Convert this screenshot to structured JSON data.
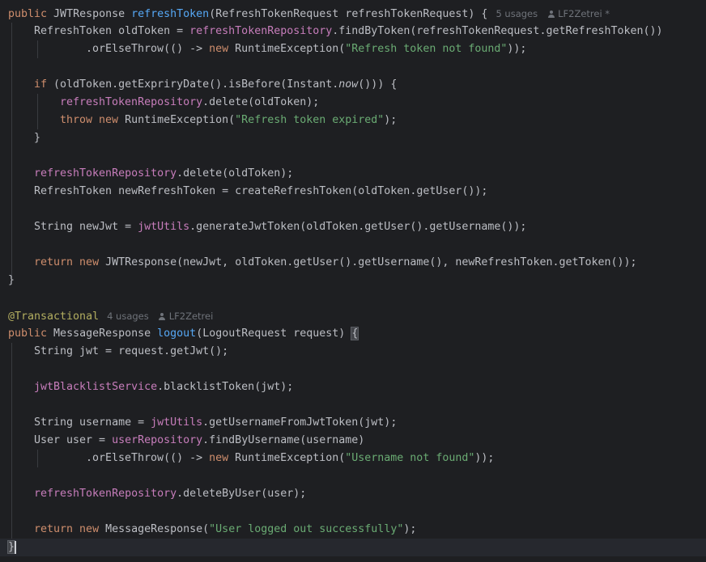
{
  "method1": {
    "l1": {
      "kw": "public",
      "type": " JWTResponse ",
      "name": "refreshToken",
      "params": "(RefreshTokenRequest refreshTokenRequest) {",
      "usages": "5 usages",
      "author": "LF2Zetrei *"
    },
    "l2": {
      "a": "RefreshToken oldToken = ",
      "fld": "refreshTokenRepository",
      "b": ".findByToken(refreshTokenRequest.getRefreshToken())"
    },
    "l3": {
      "a": ".orElseThrow(() -> ",
      "kw": "new",
      "b": " RuntimeException(",
      "str": "\"Refresh token not found\"",
      "c": "));"
    },
    "l5": {
      "kw": "if",
      "a": " (oldToken.getExpriryDate().isBefore(Instant.",
      "ital": "now",
      "b": "())) {"
    },
    "l6": {
      "fld": "refreshTokenRepository",
      "a": ".delete(oldToken);"
    },
    "l7": {
      "kw1": "throw",
      "kw2": " new",
      "a": " RuntimeException(",
      "str": "\"Refresh token expired\"",
      "b": ");"
    },
    "l8": {
      "a": "}"
    },
    "l10": {
      "fld": "refreshTokenRepository",
      "a": ".delete(oldToken);"
    },
    "l11": {
      "a": "RefreshToken newRefreshToken = createRefreshToken(oldToken.getUser());"
    },
    "l13": {
      "a": "String newJwt = ",
      "fld": "jwtUtils",
      "b": ".generateJwtToken(oldToken.getUser().getUsername());"
    },
    "l15": {
      "kw1": "return",
      "kw2": " new",
      "a": " JWTResponse(newJwt, oldToken.getUser().getUsername(), newRefreshToken.getToken());"
    },
    "l16": {
      "a": "}"
    }
  },
  "method2": {
    "l18": {
      "ann": "@Transactional",
      "usages": "4 usages",
      "author": "LF2Zetrei"
    },
    "l19": {
      "kw": "public",
      "type": " MessageResponse ",
      "name": "logout",
      "params": "(LogoutRequest request) ",
      "brace": "{"
    },
    "l20": {
      "a": "String jwt = request.getJwt();"
    },
    "l22": {
      "fld": "jwtBlacklistService",
      "a": ".blacklistToken(jwt);"
    },
    "l24": {
      "a": "String username = ",
      "fld": "jwtUtils",
      "b": ".getUsernameFromJwtToken(jwt);"
    },
    "l25": {
      "a": "User user = ",
      "fld": "userRepository",
      "b": ".findByUsername(username)"
    },
    "l26": {
      "a": ".orElseThrow(() -> ",
      "kw": "new",
      "b": " RuntimeException(",
      "str": "\"Username not found\"",
      "c": "));"
    },
    "l28": {
      "fld": "refreshTokenRepository",
      "a": ".deleteByUser(user);"
    },
    "l30": {
      "kw1": "return",
      "kw2": " new",
      "a": " MessageResponse(",
      "str": "\"User logged out successfully\"",
      "b": ");"
    },
    "l31": {
      "a": "}"
    }
  }
}
